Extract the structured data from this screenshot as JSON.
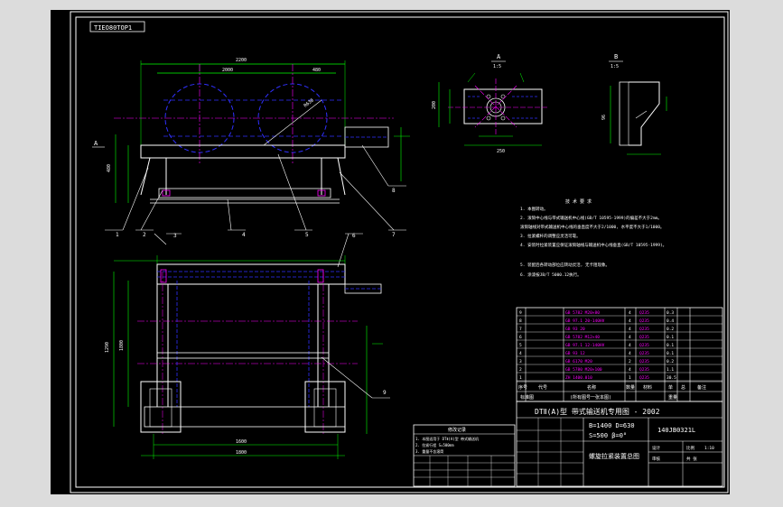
{
  "drawing": {
    "tag": "TIEO80TOP1",
    "title_block": {
      "main_title": "DTⅡ(A)型  带式输送机专用图 - 2002",
      "params_line1": "B=1400  D=630",
      "params_line2": "S=500  β=0°",
      "drawing_no": "140JB0321L",
      "name": "螺旋拉紧装置总图"
    },
    "bom_header": {
      "seq": "序号",
      "code": "代号",
      "name": "名称",
      "qty": "数量",
      "material": "材料",
      "weight_single": "单",
      "weight_total": "总",
      "note": "备注"
    },
    "bom_header_lower": {
      "text1": "标准图",
      "text2": "(所有图号一张本图)",
      "text3": "重量"
    },
    "bom_rows": [
      {
        "seq": "9",
        "code": "",
        "name": "GB 5782 M20×80",
        "qty": "4",
        "material": "Q235",
        "w": "0.3"
      },
      {
        "seq": "8",
        "code": "",
        "name": "GB 97.1 20-140HV",
        "qty": "4",
        "material": "Q235",
        "w": "0.4"
      },
      {
        "seq": "7",
        "code": "",
        "name": "GB 93 20",
        "qty": "4",
        "material": "Q235",
        "w": "0.2"
      },
      {
        "seq": "6",
        "code": "",
        "name": "GB 5782 M12×40",
        "qty": "4",
        "material": "Q235",
        "w": "0.1"
      },
      {
        "seq": "5",
        "code": "",
        "name": "GB 97.1 12-140HV",
        "qty": "4",
        "material": "Q235",
        "w": "0.1"
      },
      {
        "seq": "4",
        "code": "",
        "name": "GB 93 12",
        "qty": "4",
        "material": "Q235",
        "w": "0.1"
      },
      {
        "seq": "3",
        "code": "",
        "name": "GB 6170 M20",
        "qty": "2",
        "material": "Q235",
        "w": "0.2"
      },
      {
        "seq": "2",
        "code": "",
        "name": "GB 5780 M20×100",
        "qty": "4",
        "material": "Q235",
        "w": "1.1"
      },
      {
        "seq": "1",
        "code": "",
        "name": "ZH 1400.010",
        "qty": "1",
        "material": "Q235",
        "w": "30.5"
      }
    ],
    "tech_notes": {
      "title": "技 术 要 求",
      "items": [
        "1. 本图转动。",
        "2. 滚筒中心线与带式输送机中心线(GB/T 10595-1999)的偏差不大于2mm。",
        "   滚筒轴线对带式输送机中心线的垂直度不大于2/1000, 水平度不大于1/1000。",
        "3. 拉紧螺杆的调整应灵活可靠。",
        "4. 安装时拉紧装置应保证滚筒轴线与输送机中心线垂直(GB/T 10595-1999)。",
        "5. 装配后各转动部位应转动灵活, 无卡阻现象。",
        "6. 涂漆按JB/T 5000.12执行。"
      ]
    },
    "change_table": {
      "title": "修改记录",
      "rows": [
        "1. 本图适用于 DTⅡ(A)型 带式输送机",
        "2. 拉紧行程 S=500mm",
        "3. 重量不含滚筒"
      ]
    },
    "views": {
      "section_a": "A",
      "section_a_ref": "1:5",
      "section_b": "B",
      "section_b_ref": "1:5",
      "front_view_label": "A"
    },
    "balloons": [
      "1",
      "2",
      "3",
      "4",
      "5",
      "6",
      "7",
      "8",
      "9"
    ],
    "dims": {
      "overall_top": "2200",
      "top_sub1": "2000",
      "top_sub2": "480",
      "height_left": "480",
      "plan_width": "1800",
      "plan_bottom": "1600",
      "plan_bottom2": "1800",
      "plan_left": "1290",
      "detail_a_w": "250",
      "detail_a_h": "200",
      "detail_b_h": "96"
    },
    "title_block_labels": {
      "design": "设计",
      "check": "审核",
      "scale": "比例",
      "sheet": "共 张",
      "scale_value": "1:10"
    }
  }
}
